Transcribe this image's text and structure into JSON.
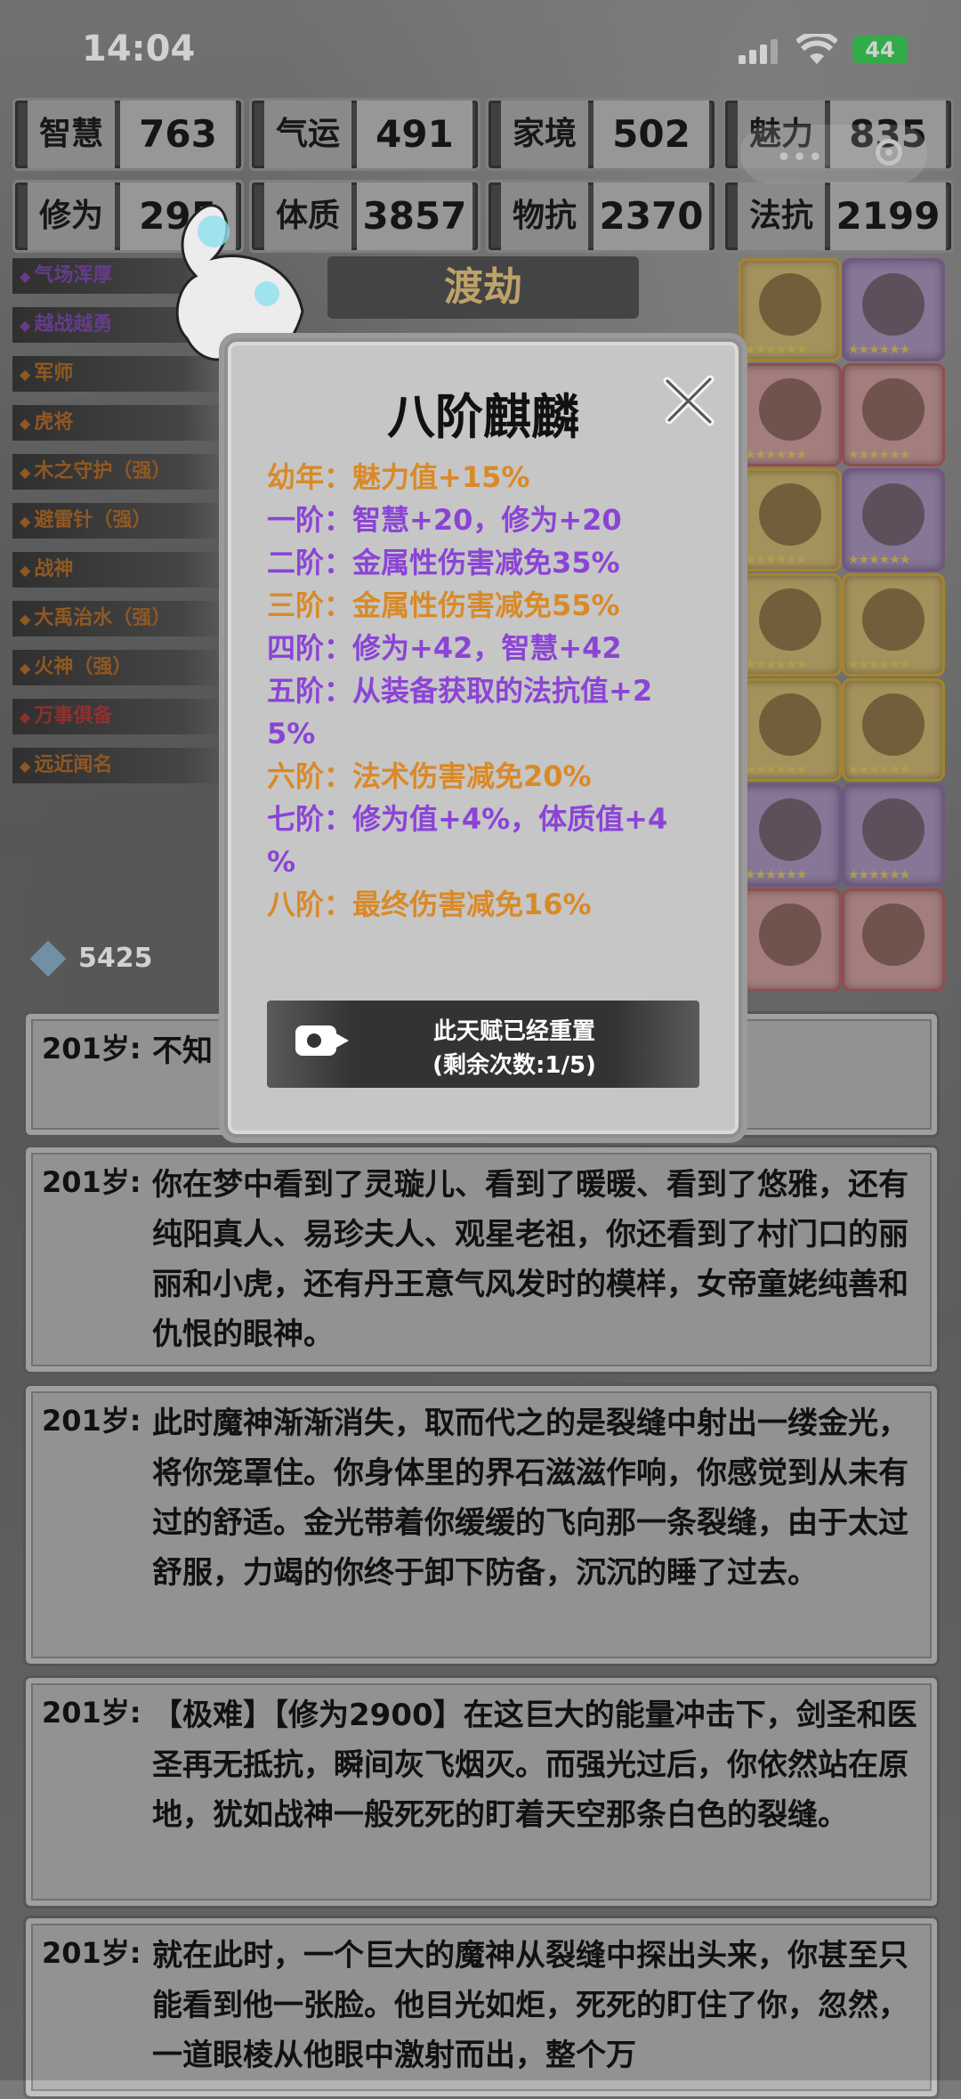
{
  "status": {
    "time": "14:04",
    "battery": "44"
  },
  "stats": [
    {
      "label": "智慧",
      "value": "763"
    },
    {
      "label": "气运",
      "value": "491"
    },
    {
      "label": "家境",
      "value": "502"
    },
    {
      "label": "魅力",
      "value": "835"
    },
    {
      "label": "修为",
      "value": "295"
    },
    {
      "label": "体质",
      "value": "3857"
    },
    {
      "label": "物抗",
      "value": "2370"
    },
    {
      "label": "法抗",
      "value": "2199"
    }
  ],
  "stage_title": "渡劫",
  "talents": [
    {
      "name": "气场浑厚",
      "color": "pur"
    },
    {
      "name": "越战越勇",
      "color": "pur"
    },
    {
      "name": "军师",
      "color": "ore"
    },
    {
      "name": "虎将",
      "color": "ore"
    },
    {
      "name": "木之守护（强）",
      "color": "ore"
    },
    {
      "name": "避雷针（强）",
      "color": "ore"
    },
    {
      "name": "战神",
      "color": "ore"
    },
    {
      "name": "大禹治水（强）",
      "color": "ore"
    },
    {
      "name": "火神（强）",
      "color": "ore"
    },
    {
      "name": "万事俱备",
      "color": "red"
    },
    {
      "name": "远近闻名",
      "color": "ore"
    }
  ],
  "gems": "5425",
  "modal": {
    "title": "八阶麒麟",
    "levels": [
      {
        "text": "幼年：魅力值+15%",
        "color": "o"
      },
      {
        "text": "一阶：智慧+20，修为+20",
        "color": "p"
      },
      {
        "text": "二阶：金属性伤害减免35%",
        "color": "p"
      },
      {
        "text": "三阶：金属性伤害减免55%",
        "color": "o"
      },
      {
        "text": "四阶：修为+42，智慧+42",
        "color": "p"
      },
      {
        "text": "五阶：从装备获取的法抗值+2",
        "color": "p"
      },
      {
        "text": "5%",
        "color": "p"
      },
      {
        "text": "六阶：法术伤害减免20%",
        "color": "o"
      },
      {
        "text": "七阶：修为值+4%，体质值+4",
        "color": "p"
      },
      {
        "text": "%",
        "color": "p"
      },
      {
        "text": "八阶：最终伤害减免16%",
        "color": "o"
      }
    ],
    "reset_line1": "此天赋已经重置",
    "reset_line2": "(剩余次数:1/5)"
  },
  "logs": [
    {
      "age": "201岁:",
      "text": "不知                                                    你缓缓的睁开了"
    },
    {
      "age": "201岁:",
      "text": "你在梦中看到了灵璇儿、看到了暖暖、看到了悠雅，还有纯阳真人、易珍夫人、观星老祖，你还看到了村门口的丽丽和小虎，还有丹王意气风发时的模样，女帝童姥纯善和仇恨的眼神。"
    },
    {
      "age": "201岁:",
      "text": "此时魔神渐渐消失，取而代之的是裂缝中射出一缕金光，将你笼罩住。你身体里的界石滋滋作响，你感觉到从未有过的舒适。金光带着你缓缓的飞向那一条裂缝，由于太过舒服，力竭的你终于卸下防备，沉沉的睡了过去。"
    },
    {
      "age": "201岁:",
      "text": "【极难】【修为2900】在这巨大的能量冲击下，剑圣和医圣再无抵抗，瞬间灰飞烟灭。而强光过后，你依然站在原地，犹如战神一般死死的盯着天空那条白色的裂缝。"
    },
    {
      "age": "201岁:",
      "text": "就在此时，一个巨大的魔神从裂缝中探出头来，你甚至只能看到他一张脸。他目光如炬，死死的盯住了你，忽然，一道眼棱从他眼中激射而出，整个万"
    }
  ]
}
